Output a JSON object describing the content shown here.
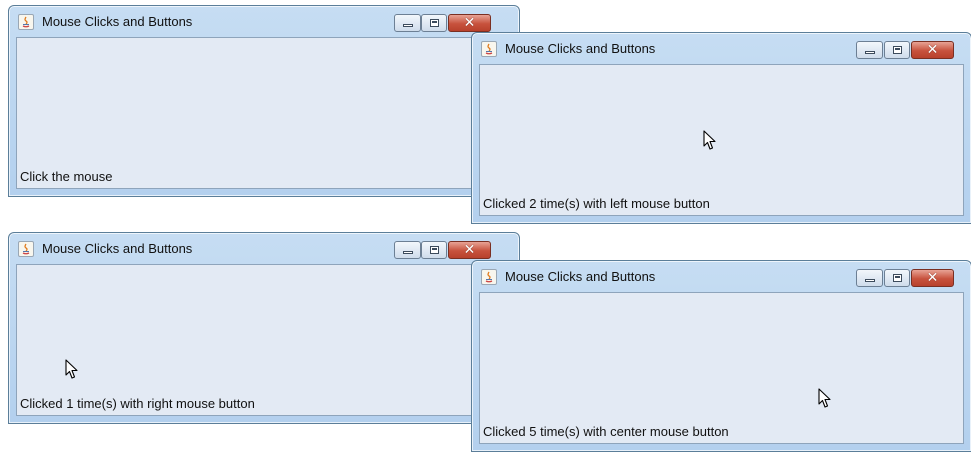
{
  "app_title": "Mouse Clicks and Buttons",
  "windows": [
    {
      "status": "Click the mouse"
    },
    {
      "status": "Clicked 2 time(s) with left mouse button"
    },
    {
      "status": "Clicked 1 time(s) with right mouse button"
    },
    {
      "status": "Clicked 5 time(s) with center mouse button"
    }
  ],
  "icons": {
    "app": "java-icon",
    "minimize": "minimize-icon",
    "maximize": "maximize-icon",
    "close": "close-icon",
    "pointer": "mouse-pointer-icon"
  },
  "colors": {
    "frame": "#b3d0ee",
    "content": "#e3eaf4",
    "close": "#c7523d"
  },
  "controls": {
    "close_glyph": "✕"
  }
}
